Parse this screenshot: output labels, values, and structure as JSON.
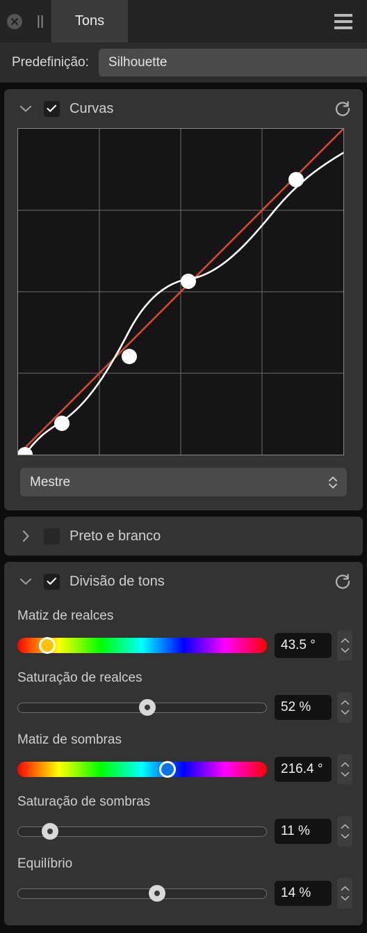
{
  "window": {
    "close_icon": "close-circle-icon",
    "pause_icon": "pause-bars-icon",
    "tab_label": "Tons",
    "menu_icon": "hamburger-menu-icon"
  },
  "preset": {
    "label": "Predefinição:",
    "value": "Silhouette"
  },
  "curves_panel": {
    "expand_icon": "chevron-down-icon",
    "checked": true,
    "title": "Curvas",
    "reset_icon": "reset-circular-arrow-icon",
    "channel_select": {
      "value": "Mestre",
      "stepper_icon": "chevron-up-down-icon"
    }
  },
  "bw_panel": {
    "expand_icon": "chevron-right-icon",
    "checked": false,
    "title": "Preto e branco"
  },
  "split_panel": {
    "expand_icon": "chevron-down-icon",
    "checked": true,
    "title": "Divisão de tons",
    "reset_icon": "reset-circular-arrow-icon",
    "rows": [
      {
        "label": "Matiz de realces",
        "type": "hue",
        "value": "43.5 °",
        "percent": 12.1,
        "thumb_color": "#ffc400"
      },
      {
        "label": "Saturação de realces",
        "type": "plain",
        "value": "52 %",
        "percent": 52.0,
        "thumb_color": "#d9d9d9"
      },
      {
        "label": "Matiz de sombras",
        "type": "hue",
        "value": "216.4 °",
        "percent": 60.1,
        "thumb_color": "#0a74e8"
      },
      {
        "label": "Saturação de sombras",
        "type": "plain",
        "value": "11 %",
        "percent": 13.0,
        "thumb_color": "#d9d9d9"
      },
      {
        "label": "Equilíbrio",
        "type": "plain",
        "value": "14 %",
        "percent": 56.0,
        "thumb_color": "#d9d9d9"
      }
    ]
  },
  "chart_data": {
    "type": "line",
    "title": "Curvas - Mestre",
    "xlabel": "",
    "ylabel": "",
    "xlim": [
      0,
      255
    ],
    "ylim": [
      0,
      255
    ],
    "grid": true,
    "grid_divisions": 4,
    "colors": {
      "curve": "#ffffff",
      "reference": "#e8412a",
      "point": "#ffffff",
      "background": "#151515",
      "gridline": "#707070"
    },
    "series": [
      {
        "name": "reference-diagonal",
        "x": [
          0,
          255
        ],
        "y": [
          0,
          255
        ]
      },
      {
        "name": "tone-curve",
        "control_points": [
          {
            "x": 0,
            "y": 0
          },
          {
            "x": 29,
            "y": 23
          },
          {
            "x": 82,
            "y": 76
          },
          {
            "x": 129,
            "y": 137
          },
          {
            "x": 213,
            "y": 218
          },
          {
            "x": 255,
            "y": 245
          }
        ]
      }
    ]
  }
}
